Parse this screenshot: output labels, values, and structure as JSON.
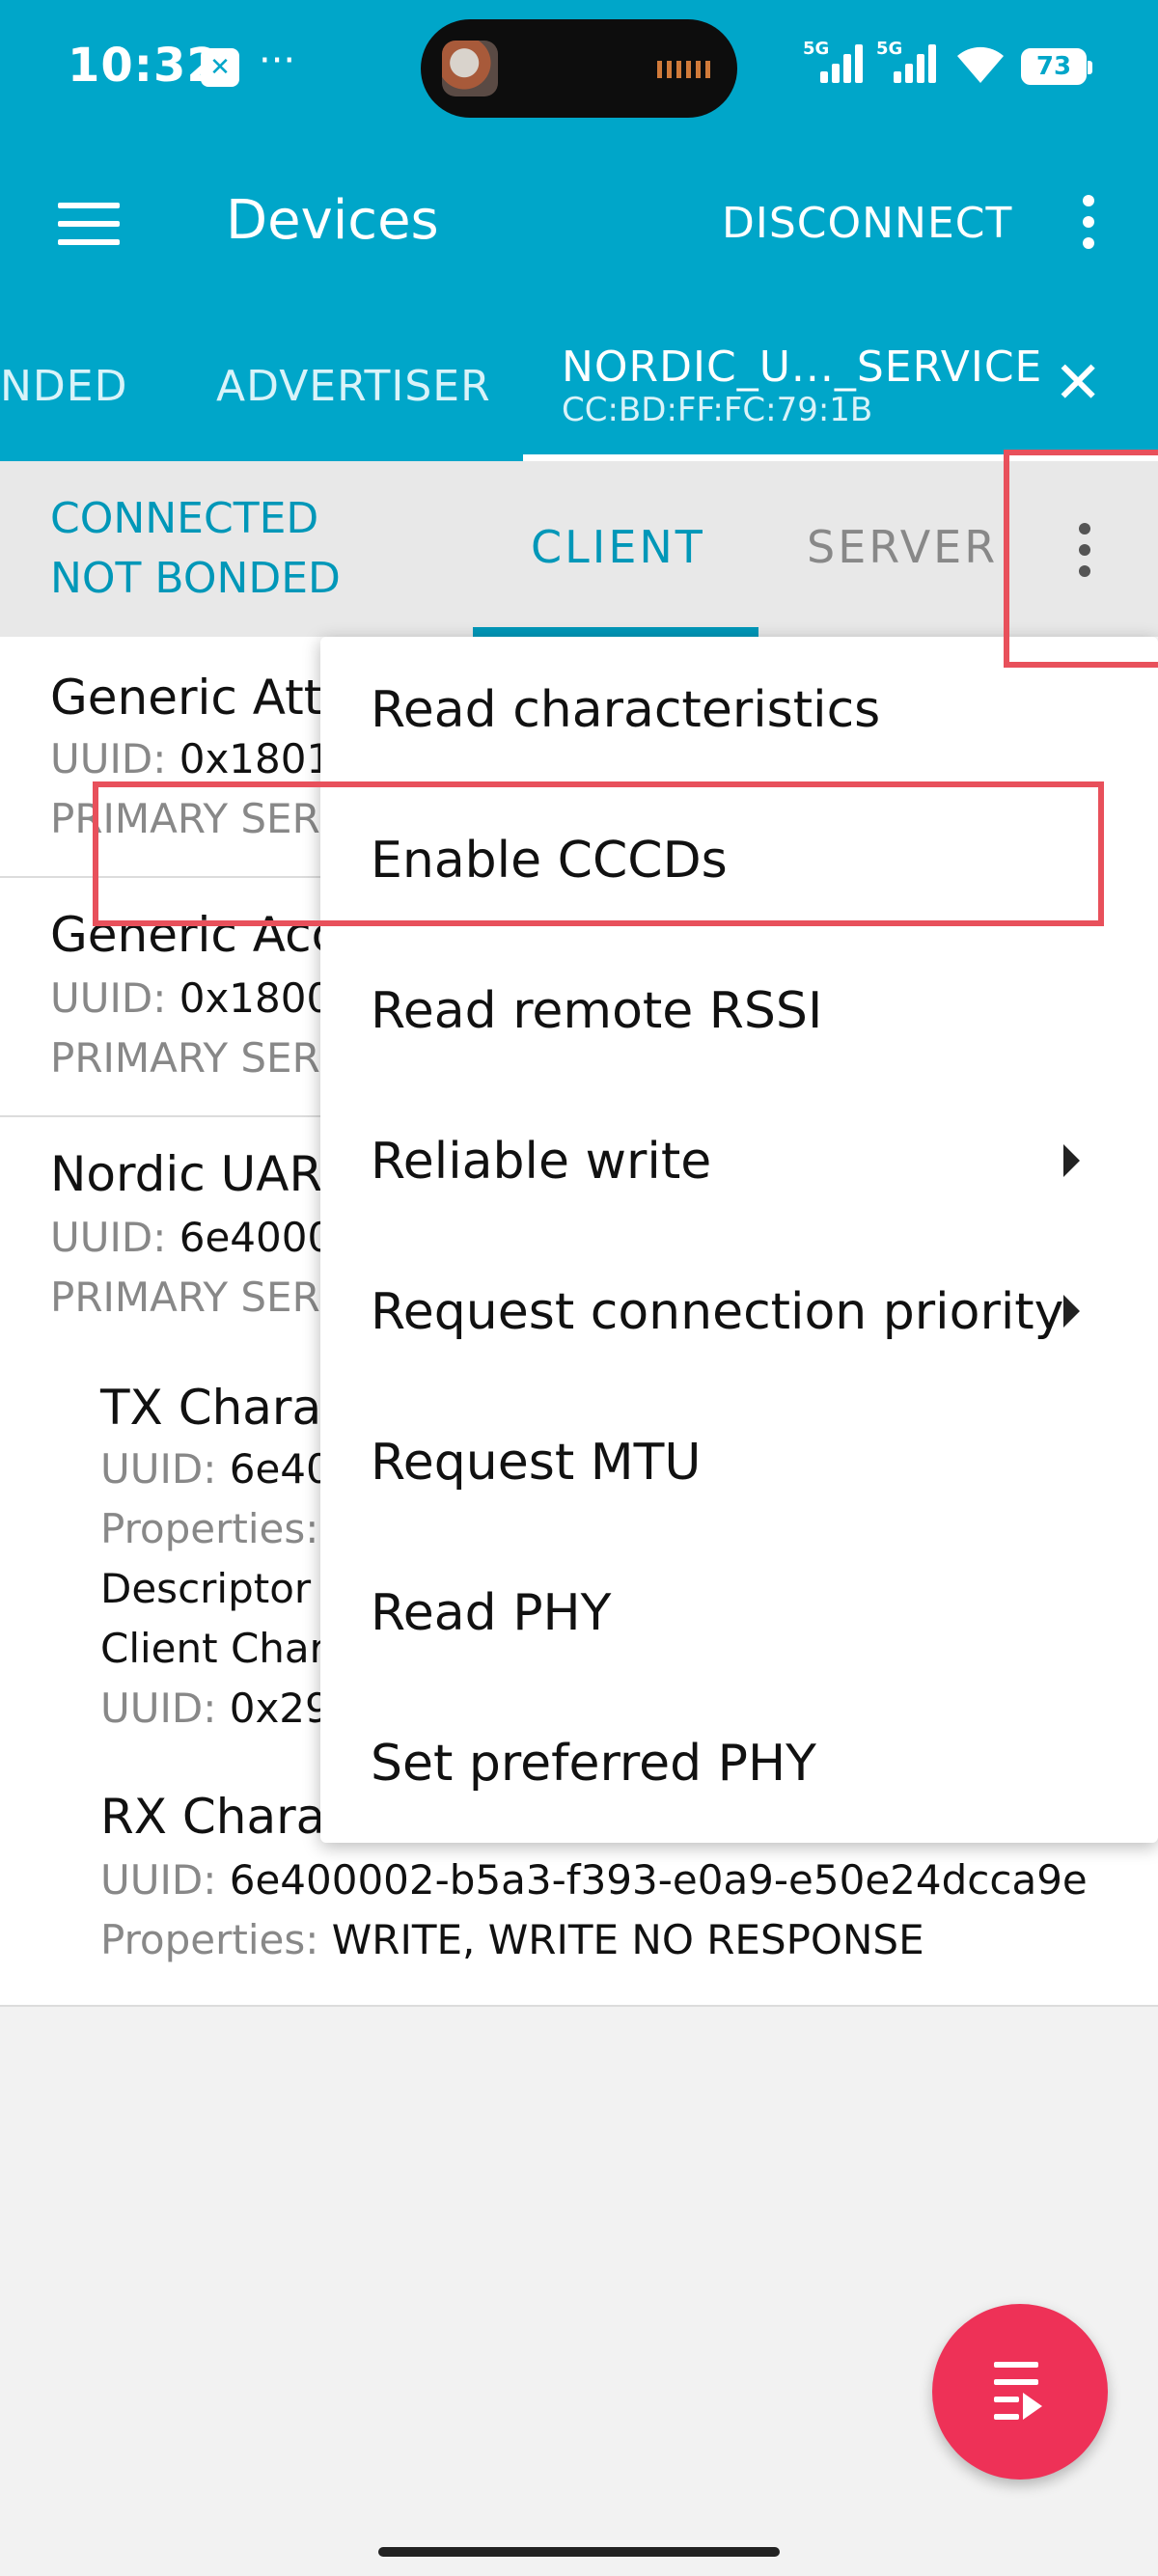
{
  "status_bar": {
    "time": "10:32",
    "app_icon": "app-notification-icon",
    "more": "···",
    "signal_1_label": "5G",
    "signal_2_label": "5G",
    "battery": "73"
  },
  "app_bar": {
    "title": "Devices",
    "disconnect_label": "DISCONNECT"
  },
  "device_tabs": {
    "tabs": [
      "NDED",
      "ADVERTISER"
    ],
    "active_tab": {
      "name": "NORDIC_U..._SERVICE",
      "address": "CC:BD:FF:FC:79:1B"
    },
    "close_icon": "✕"
  },
  "connection": {
    "state": "CONNECTED",
    "bond": "NOT BONDED",
    "tab_client": "CLIENT",
    "tab_server": "SERVER"
  },
  "services": [
    {
      "name": "Generic Attr",
      "uuid_label": "UUID:",
      "uuid": "0x1801",
      "type": "PRIMARY SER"
    },
    {
      "name": "Generic Acc",
      "uuid_label": "UUID:",
      "uuid": "0x1800",
      "type": "PRIMARY SER"
    },
    {
      "name": "Nordic UAR",
      "uuid_label": "UUID:",
      "uuid": "6e4000",
      "type": "PRIMARY SER"
    }
  ],
  "characteristics": {
    "tx": {
      "name": "TX Chara",
      "uuid_label": "UUID:",
      "uuid": "6e40",
      "props_label": "Properties:",
      "descriptor_heading": "Descriptor",
      "descriptor_name": "Client Char",
      "descriptor_uuid_label": "UUID:",
      "descriptor_uuid": "0x29"
    },
    "rx": {
      "name": "RX Chara",
      "uuid_label": "UUID:",
      "uuid": "6e400002-b5a3-f393-e0a9-e50e24dcca9e",
      "props_label": "Properties:",
      "props": "WRITE, WRITE NO RESPONSE"
    }
  },
  "menu": {
    "items": [
      "Read characteristics",
      "Enable CCCDs",
      "Read remote RSSI",
      "Reliable write",
      "Request connection priority",
      "Request MTU",
      "Read PHY",
      "Set preferred PHY"
    ]
  },
  "colors": {
    "primary": "#00a6c9",
    "accent": "#0097b8",
    "fab": "#ee3157",
    "highlight": "#e8505b"
  }
}
